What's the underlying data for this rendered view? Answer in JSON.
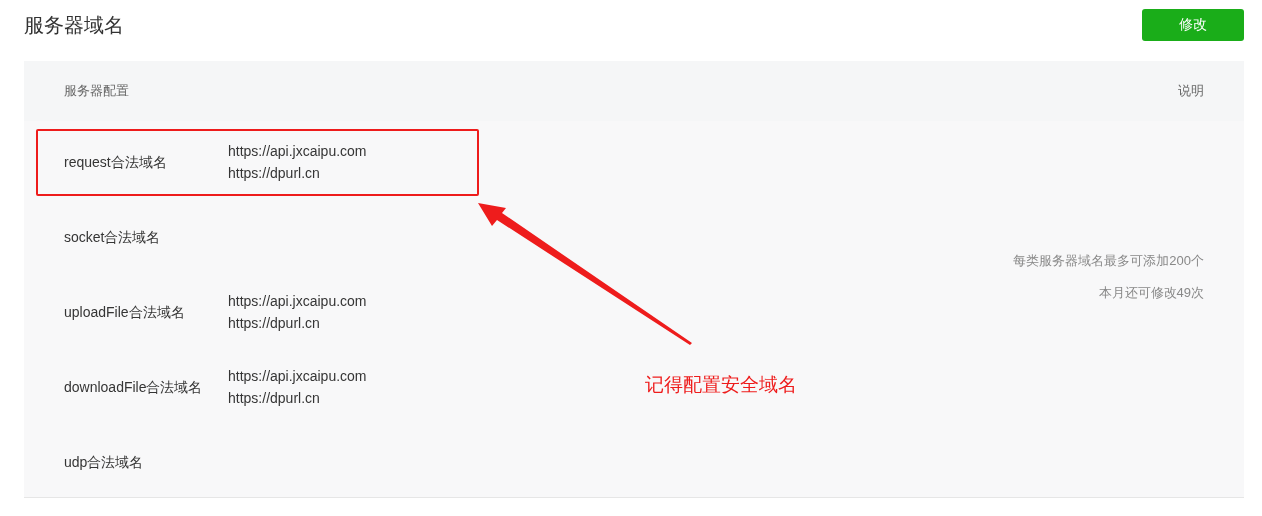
{
  "title": "服务器域名",
  "edit_button": "修改",
  "table": {
    "header": {
      "config": "服务器配置",
      "notes": "说明"
    },
    "rows": [
      {
        "label": "request合法域名",
        "domains": [
          "https://api.jxcaipu.com",
          "https://dpurl.cn"
        ],
        "highlighted": true
      },
      {
        "label": "socket合法域名",
        "domains": [],
        "highlighted": false
      },
      {
        "label": "uploadFile合法域名",
        "domains": [
          "https://api.jxcaipu.com",
          "https://dpurl.cn"
        ],
        "highlighted": false
      },
      {
        "label": "downloadFile合法域名",
        "domains": [
          "https://api.jxcaipu.com",
          "https://dpurl.cn"
        ],
        "highlighted": false
      },
      {
        "label": "udp合法域名",
        "domains": [],
        "highlighted": false
      }
    ],
    "notes": [
      "每类服务器域名最多可添加200个",
      "本月还可修改49次"
    ]
  },
  "annotation": {
    "text": "记得配置安全域名"
  }
}
